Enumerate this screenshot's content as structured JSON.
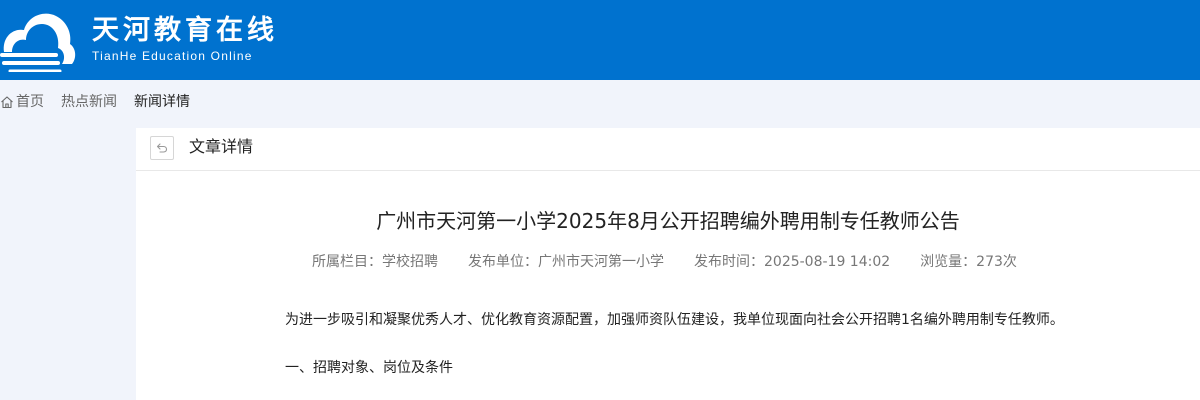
{
  "header": {
    "title": "天河教育在线",
    "subtitle": "TianHe Education Online",
    "logo_icon": "cloud-logo-icon",
    "background_color": "#0072cf"
  },
  "breadcrumb": {
    "home_icon": "home-icon",
    "items": [
      "首页",
      "热点新闻",
      "新闻详情"
    ]
  },
  "panel": {
    "back_icon": "back-arrow-icon",
    "heading": "文章详情"
  },
  "article": {
    "title": "广州市天河第一小学2025年8月公开招聘编外聘用制专任教师公告",
    "meta": {
      "column_label": "所属栏目：",
      "column_value": "学校招聘",
      "publisher_label": "发布单位：",
      "publisher_value": "广州市天河第一小学",
      "time_label": "发布时间：",
      "time_value": "2025-08-19 14:02",
      "views_label": "浏览量：",
      "views_value": "273次"
    },
    "paragraphs": [
      "为进一步吸引和凝聚优秀人才、优化教育资源配置，加强师资队伍建设，我单位现面向社会公开招聘1名编外聘用制专任教师。",
      "一、招聘对象、岗位及条件"
    ]
  }
}
